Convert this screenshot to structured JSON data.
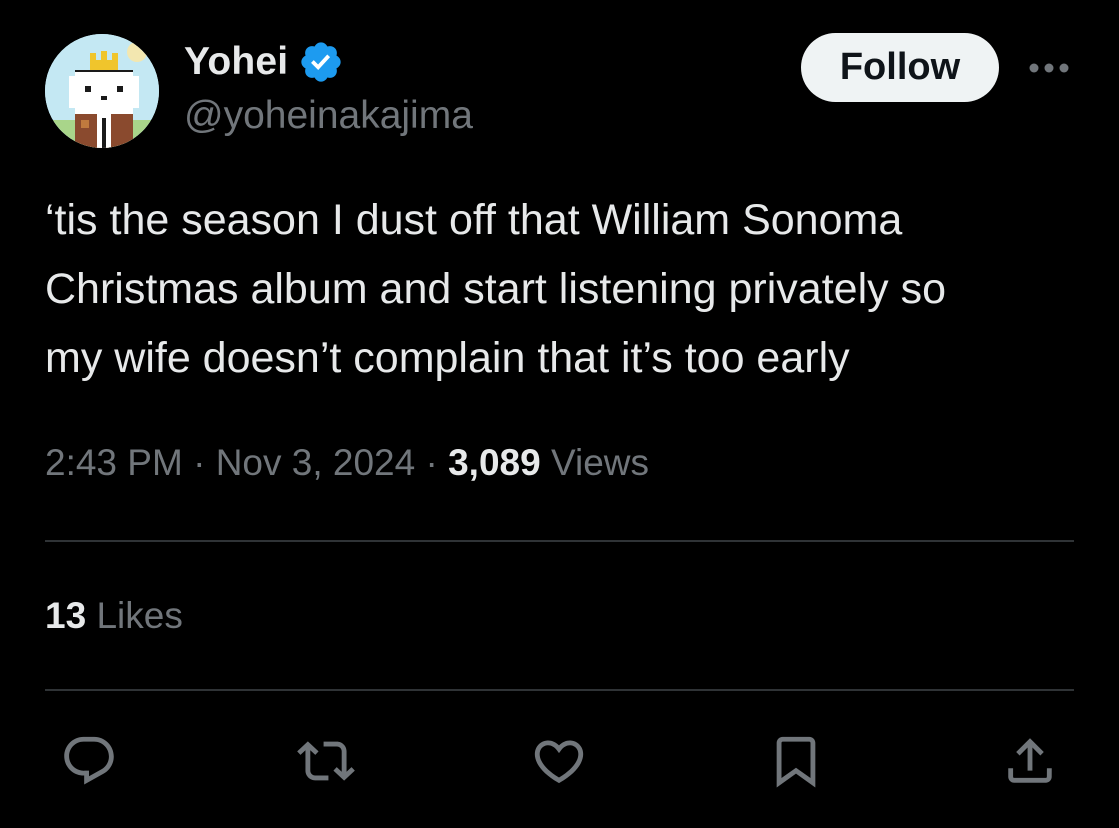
{
  "author": {
    "display_name": "Yohei",
    "handle": "@yoheinakajima",
    "verified_icon": "verified-badge-icon",
    "avatar_icon": "pixel-cat-with-crown-avatar"
  },
  "follow_button": {
    "label": "Follow"
  },
  "more_menu": {
    "icon": "more-horizontal-icon"
  },
  "tweet": {
    "text": "‘tis the season I dust off that William Sonoma\nChristmas album and start listening privately so\nmy wife doesn’t complain that it’s too early"
  },
  "meta": {
    "time": "2:43 PM",
    "separator": " · ",
    "date": "Nov 3, 2024",
    "views_count": "3,089",
    "views_label": "Views"
  },
  "engagement": {
    "likes_count": "13",
    "likes_label": "Likes"
  },
  "actions": [
    {
      "name": "reply",
      "icon": "reply-icon"
    },
    {
      "name": "repost",
      "icon": "repost-icon"
    },
    {
      "name": "like",
      "icon": "heart-icon"
    },
    {
      "name": "bookmark",
      "icon": "bookmark-icon"
    },
    {
      "name": "share",
      "icon": "share-icon"
    }
  ],
  "colors": {
    "background": "#000000",
    "primary_text": "#e7e9ea",
    "secondary_text": "#71767b",
    "divider": "#2f3336",
    "verified_blue": "#1d9bf0",
    "follow_bg": "#eff3f4"
  }
}
